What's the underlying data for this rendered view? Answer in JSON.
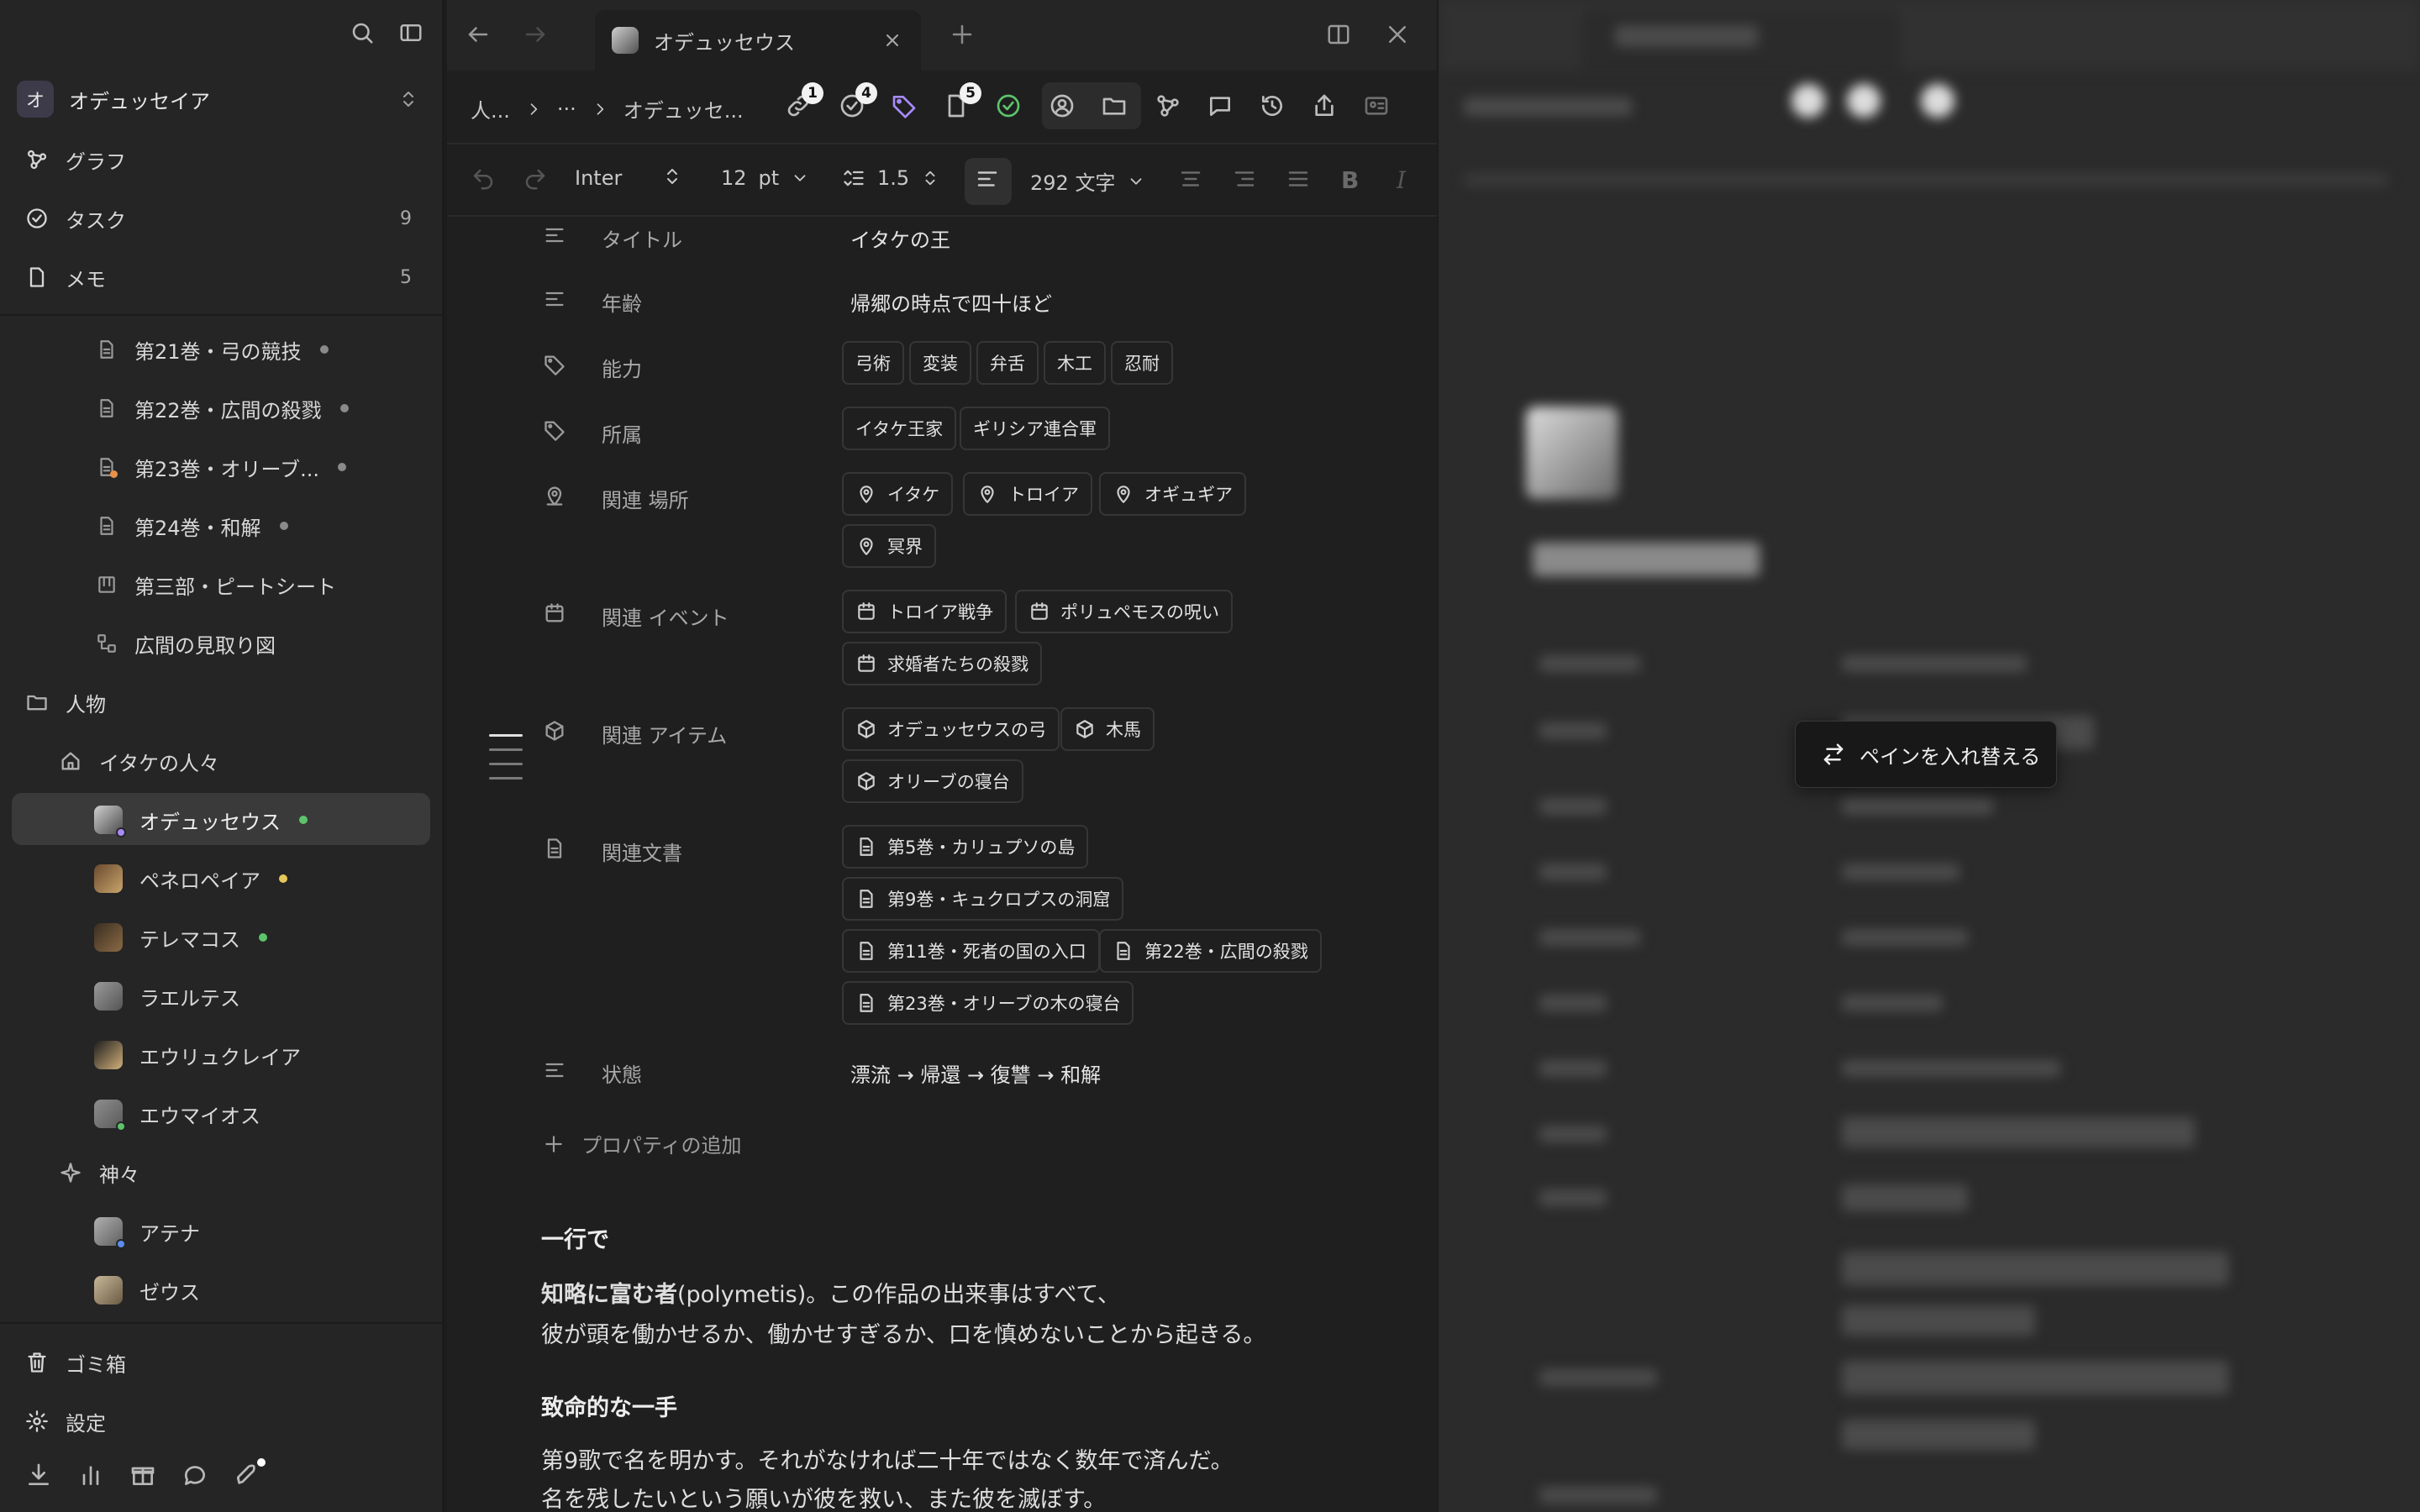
{
  "sidebar": {
    "workspace_badge": "オ",
    "workspace_name": "オデュッセイア",
    "nav": [
      {
        "label": "グラフ",
        "count": ""
      },
      {
        "label": "タスク",
        "count": "9"
      },
      {
        "label": "メモ",
        "count": "5"
      }
    ],
    "chapters": [
      {
        "label": "第21巻・弓の競技"
      },
      {
        "label": "第22巻・広間の殺戮"
      },
      {
        "label": "第23巻・オリーブ..."
      },
      {
        "label": "第24巻・和解"
      },
      {
        "label": "第三部・ピートシート"
      },
      {
        "label": "広間の見取り図"
      }
    ],
    "folder_people": "人物",
    "group_ithaca": "イタケの人々",
    "people": [
      {
        "label": "オデュッセウス"
      },
      {
        "label": "ペネロペイア"
      },
      {
        "label": "テレマコス"
      },
      {
        "label": "ラエルテス"
      },
      {
        "label": "エウリュクレイア"
      },
      {
        "label": "エウマイオス"
      }
    ],
    "group_gods": "神々",
    "gods": [
      {
        "label": "アテナ"
      },
      {
        "label": "ゼウス"
      }
    ],
    "trash": "ゴミ箱",
    "settings": "設定"
  },
  "colors": {
    "status_green": "#5cc46a",
    "status_yellow": "#e6c75a",
    "status_grey": "#8a8a8a",
    "accent_purple": "#a78bfa"
  },
  "tab": {
    "title": "オデュッセウス"
  },
  "breadcrumb": {
    "root": "人...",
    "ellipsis": "···",
    "current": "オデュッセ..."
  },
  "toolbar_badges": {
    "links": "1",
    "tasks": "4",
    "notes": "5"
  },
  "format": {
    "font": "Inter",
    "size": "12",
    "unit": "pt",
    "line_height": "1.5",
    "word_count": "292 文字"
  },
  "properties": {
    "title": {
      "label": "タイトル",
      "value": "イタケの王"
    },
    "age": {
      "label": "年齢",
      "value": "帰郷の時点で四十ほど"
    },
    "abilities": {
      "label": "能力",
      "chips": [
        "弓術",
        "変装",
        "弁舌",
        "木工",
        "忍耐"
      ]
    },
    "affiliation": {
      "label": "所属",
      "chips": [
        "イタケ王家",
        "ギリシア連合軍"
      ]
    },
    "places": {
      "label": "関連 場所",
      "chips": [
        "イタケ",
        "トロイア",
        "オギュギア",
        "冥界"
      ]
    },
    "events": {
      "label": "関連 イベント",
      "chips": [
        "トロイア戦争",
        "ポリュペモスの呪い",
        "求婚者たちの殺戮"
      ]
    },
    "items": {
      "label": "関連 アイテム",
      "chips": [
        "オデュッセウスの弓",
        "木馬",
        "オリーブの寝台"
      ]
    },
    "docs": {
      "label": "関連文書",
      "chips": [
        "第5巻・カリュプソの島",
        "第9巻・キュクロプスの洞窟",
        "第11巻・死者の国の入口",
        "第22巻・広間の殺戮",
        "第23巻・オリーブの木の寝台"
      ]
    },
    "status": {
      "label": "状態",
      "value": "漂流 → 帰還 → 復讐 → 和解"
    },
    "add": "プロパティの追加"
  },
  "body": {
    "h1": "一行で",
    "p1a_bold": "知略に富む者",
    "p1a_rest": "(polymetis)。この作品の出来事はすべて、",
    "p1b": "彼が頭を働かせるか、働かせすぎるか、口を慎めないことから起きる。",
    "h2": "致命的な一手",
    "p2a": "第9歌で名を明かす。それがなければ二十年ではなく数年で済んだ。",
    "p2b": "名を残したいという願いが彼を救い、また彼を滅ぼす。"
  },
  "swap_button": "ペインを入れ替える"
}
